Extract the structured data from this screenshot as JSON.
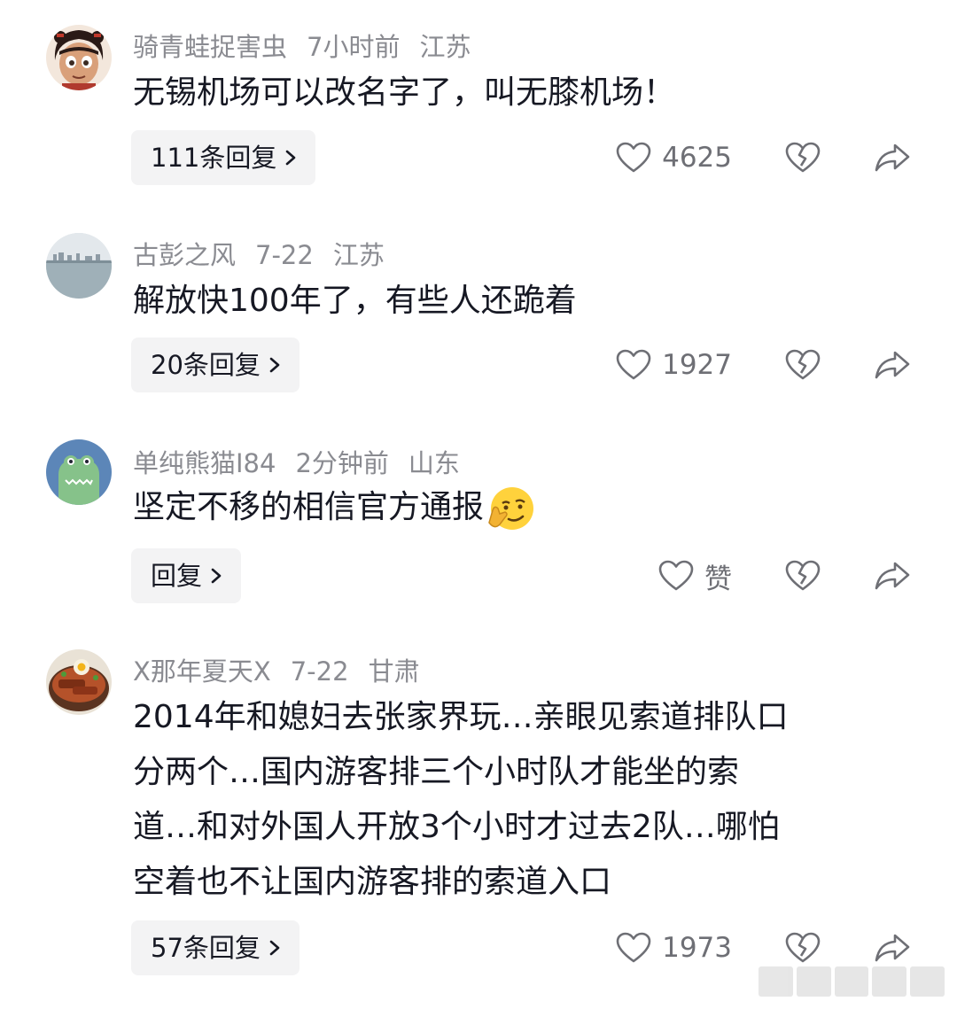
{
  "comments": [
    {
      "username": "骑青蛙捉害虫",
      "time": "7小时前",
      "location": "江苏",
      "text": "无锡机场可以改名字了，叫无膝机场！",
      "reply_label": "111条回复",
      "like_count": "4625",
      "avatar_icon": "cartoon-girl-avatar"
    },
    {
      "username": "古彭之风",
      "time": "7-22",
      "location": "江苏",
      "text": "解放快100年了，有些人还跪着",
      "reply_label": "20条回复",
      "like_count": "1927",
      "avatar_icon": "lake-scenery-avatar"
    },
    {
      "username": "单纯熊猫I84",
      "time": "2分钟前",
      "location": "山东",
      "text": "坚定不移的相信官方通报",
      "reply_label": "回复",
      "like_count": "赞",
      "avatar_icon": "green-frog-avatar",
      "emoji_icon": "smirk-thinking-emoji"
    },
    {
      "username": "X那年夏天X",
      "time": "7-22",
      "location": "甘肃",
      "text_lines": [
        "2014年和媳妇去张家界玩…亲眼见索道排队口",
        "分两个…国内游客排三个小时队才能坐的索",
        "道…和对外国人开放3个小时才过去2队…哪怕",
        "空着也不让国内游客排的索道入口"
      ],
      "reply_label": "57条回复",
      "like_count": "1973",
      "avatar_icon": "food-bowl-avatar"
    }
  ],
  "icons": {
    "like": "heart-outline-icon",
    "dislike": "broken-heart-icon",
    "share": "share-arrow-icon",
    "chevron": "chevron-right-icon"
  },
  "colors": {
    "meta_text": "#8a8b91",
    "body_text": "#161823",
    "reply_bg": "#f3f3f4",
    "icon_gray": "#6e6f75"
  }
}
